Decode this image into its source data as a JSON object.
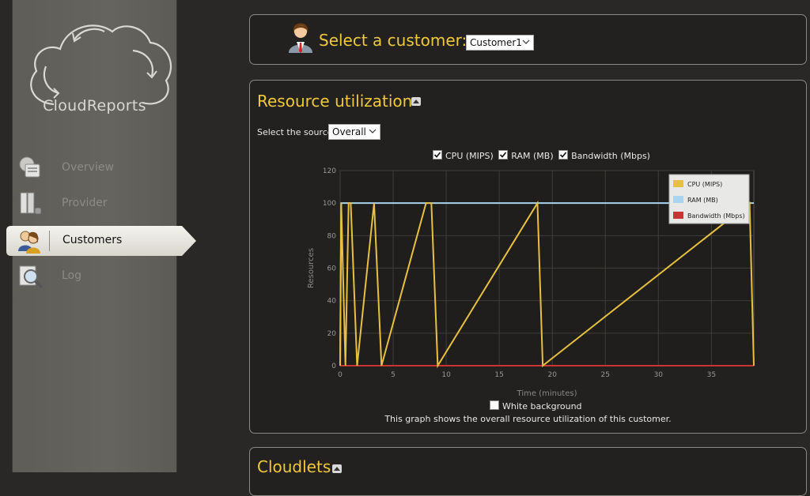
{
  "app": {
    "name": "CloudReports"
  },
  "sidebar": {
    "items": [
      {
        "label": "Overview",
        "icon": "overview-icon"
      },
      {
        "label": "Provider",
        "icon": "provider-icon"
      },
      {
        "label": "Customers",
        "icon": "customers-icon",
        "active": true
      },
      {
        "label": "Log",
        "icon": "log-icon"
      }
    ]
  },
  "customer_panel": {
    "title": "Select a customer:",
    "selected": "Customer1"
  },
  "resource_panel": {
    "title": "Resource utilization",
    "source_label": "Select the source:",
    "source_selected": "Overall",
    "checkboxes": [
      {
        "label": "CPU (MIPS)",
        "checked": true
      },
      {
        "label": "RAM (MB)",
        "checked": true
      },
      {
        "label": "Bandwidth (Mbps)",
        "checked": true
      }
    ],
    "white_background_label": "White background",
    "white_background_checked": false,
    "description": "This graph shows the overall resource utilization of this customer."
  },
  "cloudlets_panel": {
    "title": "Cloudlets"
  },
  "colors": {
    "accent": "#f0c93b",
    "cpu": "#e8c040",
    "ram": "#a8d4f0",
    "bandwidth": "#cc3333"
  },
  "chart_data": {
    "type": "line",
    "xlabel": "Time (minutes)",
    "ylabel": "Resources",
    "xlim": [
      0,
      39
    ],
    "ylim": [
      0,
      120
    ],
    "xticks": [
      0,
      5,
      10,
      15,
      20,
      25,
      30,
      35
    ],
    "yticks": [
      0,
      20,
      40,
      60,
      80,
      100,
      120
    ],
    "legend_position": "top-right",
    "series": [
      {
        "name": "CPU (MIPS)",
        "color": "#e8c040",
        "x": [
          0,
          0.1,
          0.5,
          0.8,
          1.0,
          1.6,
          3.2,
          3.9,
          8.1,
          8.6,
          9.2,
          18.6,
          19.1,
          38.6,
          39.0
        ],
        "y": [
          0,
          100,
          0,
          100,
          100,
          0,
          100,
          0,
          100,
          100,
          0,
          100,
          0,
          100,
          0
        ]
      },
      {
        "name": "RAM (MB)",
        "color": "#a8d4f0",
        "x": [
          0,
          0.1,
          39.0
        ],
        "y": [
          0,
          100,
          100
        ]
      },
      {
        "name": "Bandwidth (Mbps)",
        "color": "#cc3333",
        "x": [
          0,
          39.0
        ],
        "y": [
          0,
          0
        ]
      }
    ]
  }
}
